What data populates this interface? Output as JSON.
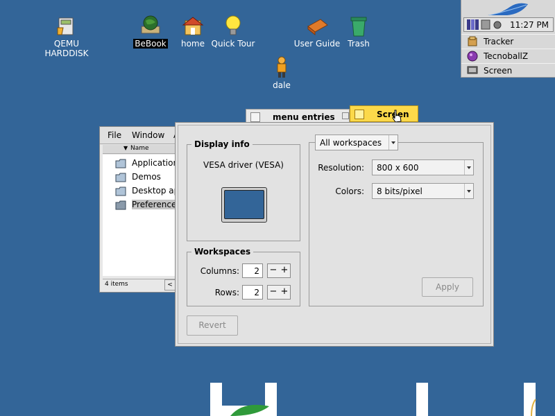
{
  "desktop": {
    "icons": [
      {
        "id": "qemu",
        "label": "QEMU HARDDISK"
      },
      {
        "id": "bebook",
        "label": "BeBook",
        "selected": true
      },
      {
        "id": "home",
        "label": "home"
      },
      {
        "id": "quicktour",
        "label": "Quick Tour"
      },
      {
        "id": "userguide",
        "label": "User Guide"
      },
      {
        "id": "trash",
        "label": "Trash"
      },
      {
        "id": "dale",
        "label": "dale"
      }
    ],
    "colors": {
      "background": "#336598",
      "logo": "#ffffff"
    }
  },
  "deskbar": {
    "clock": "11:27 PM",
    "items": [
      {
        "label": "Tracker",
        "icon": "tracker-icon"
      },
      {
        "label": "TecnoballZ",
        "icon": "tecnoballz-icon"
      },
      {
        "label": "Screen",
        "icon": "screen-icon"
      }
    ]
  },
  "tracker_window": {
    "menu": [
      "File",
      "Window",
      "A"
    ],
    "column_header": "Name",
    "items": [
      "Applications",
      "Demos",
      "Desktop app",
      "Preferences"
    ],
    "selected": "Preferences",
    "status": "4 items"
  },
  "tabs": {
    "background_tab": "menu entries",
    "active_tab": "Screen"
  },
  "screen_window": {
    "display_info": {
      "title": "Display info",
      "driver": "VESA driver (VESA)"
    },
    "workspaces": {
      "title": "Workspaces",
      "columns_label": "Columns:",
      "columns_value": "2",
      "rows_label": "Rows:",
      "rows_value": "2",
      "minus": "−",
      "plus": "+"
    },
    "scope_popup": "All workspaces",
    "resolution_label": "Resolution:",
    "resolution_value": "800 x 600",
    "colors_label": "Colors:",
    "colors_value": "8 bits/pixel",
    "apply_label": "Apply",
    "revert_label": "Revert"
  }
}
